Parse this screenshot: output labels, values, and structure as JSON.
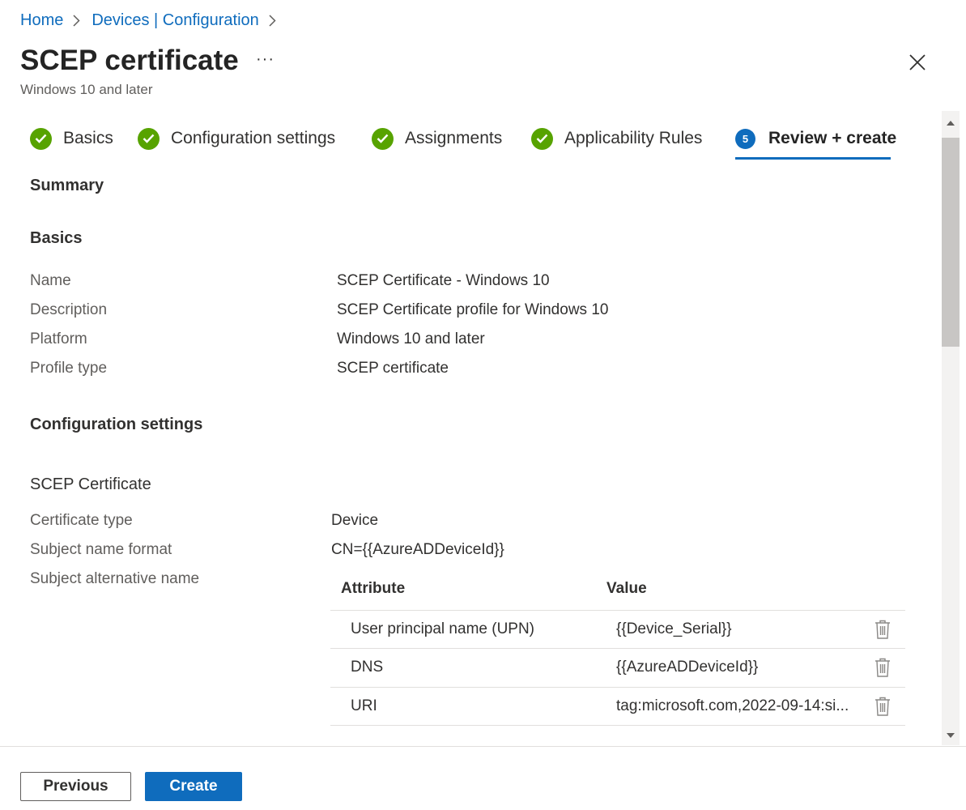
{
  "breadcrumb": {
    "home": "Home",
    "devices": "Devices | Configuration"
  },
  "header": {
    "title": "SCEP certificate",
    "more": "···",
    "subtitle": "Windows 10 and later"
  },
  "tabs": [
    {
      "label": "Basics",
      "state": "complete"
    },
    {
      "label": "Configuration settings",
      "state": "complete"
    },
    {
      "label": "Assignments",
      "state": "complete"
    },
    {
      "label": "Applicability Rules",
      "state": "complete"
    },
    {
      "label": "Review + create",
      "state": "active",
      "step": "5"
    }
  ],
  "summary": {
    "heading": "Summary",
    "basics": {
      "heading": "Basics",
      "rows": [
        {
          "label": "Name",
          "value": "SCEP Certificate - Windows 10"
        },
        {
          "label": "Description",
          "value": "SCEP Certificate profile for Windows 10"
        },
        {
          "label": "Platform",
          "value": "Windows 10 and later"
        },
        {
          "label": "Profile type",
          "value": "SCEP certificate"
        }
      ]
    },
    "config": {
      "heading": "Configuration settings",
      "subheading": "SCEP Certificate",
      "rows": [
        {
          "label": "Certificate type",
          "value": "Device"
        },
        {
          "label": "Subject name format",
          "value": "CN={{AzureADDeviceId}}"
        },
        {
          "label": "Subject alternative name",
          "value": ""
        }
      ],
      "san_table": {
        "columns": [
          "Attribute",
          "Value"
        ],
        "rows": [
          {
            "attribute": "User principal name (UPN)",
            "value": "{{Device_Serial}}"
          },
          {
            "attribute": "DNS",
            "value": "{{AzureADDeviceId}}"
          },
          {
            "attribute": "URI",
            "value": "tag:microsoft.com,2022-09-14:si..."
          }
        ]
      }
    }
  },
  "footer": {
    "previous": "Previous",
    "create": "Create"
  },
  "colors": {
    "accent": "#0f6cbd",
    "success": "#57a300"
  }
}
